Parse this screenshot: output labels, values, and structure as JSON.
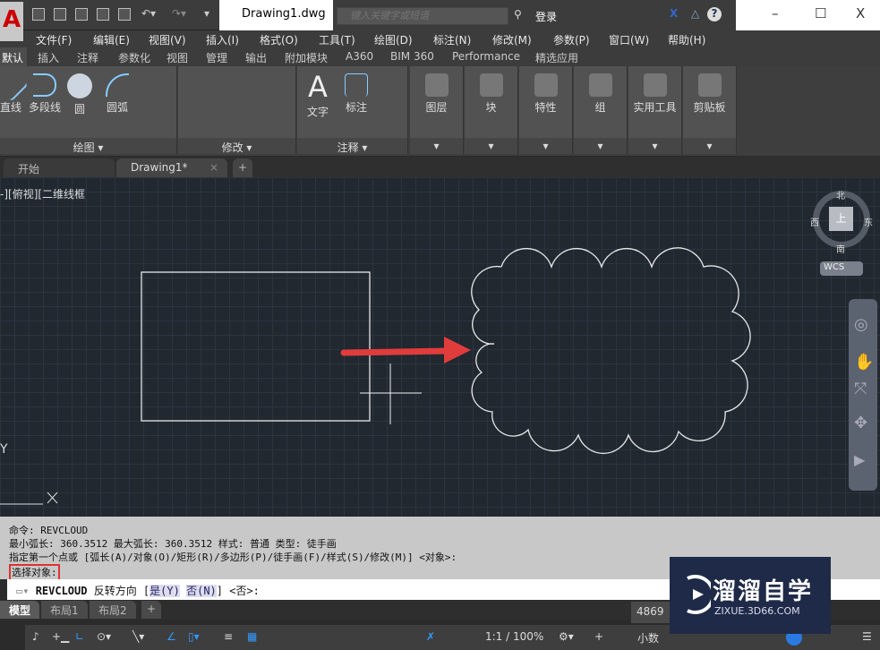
{
  "app": {
    "logo": "A",
    "title": "Drawing1.dwg",
    "search_placeholder": "键入关键字或短语",
    "login": "登录",
    "help": "?"
  },
  "window": {
    "minimize": "–",
    "maximize": "☐",
    "close": "X"
  },
  "menu": [
    "文件(F)",
    "编辑(E)",
    "视图(V)",
    "插入(I)",
    "格式(O)",
    "工具(T)",
    "绘图(D)",
    "标注(N)",
    "修改(M)",
    "参数(P)",
    "窗口(W)",
    "帮助(H)"
  ],
  "ribbon_tabs": [
    "默认",
    "插入",
    "注释",
    "参数化",
    "视图",
    "管理",
    "输出",
    "附加模块",
    "A360",
    "BIM 360",
    "Performance",
    "精选应用"
  ],
  "ribbon": {
    "draw": {
      "label": "绘图 ▾",
      "buttons": [
        "直线",
        "多段线",
        "圆",
        "圆弧"
      ]
    },
    "modify": {
      "label": "修改 ▾"
    },
    "annotation": {
      "label": "注释 ▾",
      "buttons": [
        "文字",
        "标注"
      ]
    },
    "panels": [
      "图层",
      "块",
      "特性",
      "组",
      "实用工具",
      "剪贴板"
    ]
  },
  "doc_tabs": [
    "开始",
    "Drawing1*"
  ],
  "viewport_label": "-][俯视][二维线框",
  "viewcube": {
    "n": "北",
    "s": "南",
    "e": "东",
    "w": "西",
    "top": "上",
    "wcs": "WCS"
  },
  "ucs": {
    "y": "Y",
    "x": "X"
  },
  "command": {
    "history": [
      "命令: REVCLOUD",
      "最小弧长: 360.3512   最大弧长: 360.3512   样式: 普通   类型: 徒手画",
      "指定第一个点或 [弧长(A)/对象(O)/矩形(R)/多边形(P)/徒手画(F)/样式(S)/修改(M)] <对象>:"
    ],
    "highlighted": "选择对象:",
    "prompt_cmd": "REVCLOUD",
    "prompt_text": " 反转方向 [",
    "opt_yes": "是(Y)",
    "opt_no": "否(N)",
    "prompt_end": "] <否>:"
  },
  "layout_tabs": [
    "模型",
    "布局1",
    "布局2",
    "+"
  ],
  "status": {
    "coords": "4869",
    "scale": "1:1 / 100%",
    "units": "小数"
  },
  "watermark": {
    "title": "溜溜自学",
    "url": "ZIXUE.3D66.COM"
  },
  "colors": {
    "canvas": "#212830",
    "arrow": "#e03c3c",
    "highlight_box": "#dd3333",
    "watermark_bg": "#1f2a48"
  }
}
